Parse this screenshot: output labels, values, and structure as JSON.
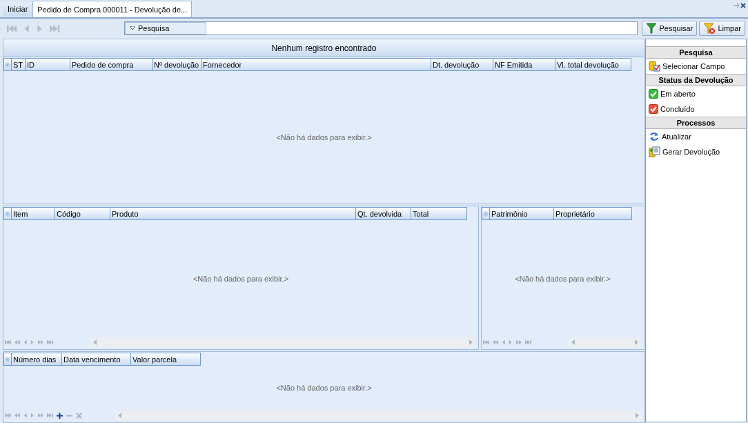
{
  "tabs": [
    {
      "label": "Iniciar",
      "selected": false
    },
    {
      "label": "Pedido de Compra 000011 - Devolução de...",
      "selected": true
    }
  ],
  "toolbar": {
    "search_dropdown": "Pesquisa",
    "buttons": [
      {
        "label": "Pesquisar",
        "kind": "filter"
      },
      {
        "label": "Limpar",
        "kind": "clear"
      }
    ]
  },
  "main_grid": {
    "caption": "Nenhum registro encontrado",
    "columns": [
      "ST",
      "ID",
      "Pedido de compra",
      "Nº devolução",
      "Fornecedor",
      "Dt. devolução",
      "NF Emitida",
      "Vl. total devolução"
    ],
    "empty_text": "<Não há dados para exibir.>"
  },
  "items_grid": {
    "columns": [
      "Item",
      "Código",
      "Produto",
      "Qt. devolvida",
      "Total"
    ],
    "empty_text": "<Não há dados para exibir.>",
    "edit_controls": false
  },
  "assets_grid": {
    "columns": [
      "Patrimônio",
      "Proprietário"
    ],
    "empty_text": "<Não há dados para exibir.>",
    "edit_controls": false
  },
  "installments_grid": {
    "columns": [
      "Número dias",
      "Data vencimento",
      "Valor parcela"
    ],
    "empty_text": "<Não há dados para exibir.>",
    "edit_controls": true
  },
  "side_panel": {
    "sections": [
      {
        "title": "Pesquisa",
        "items": [
          {
            "label": "Selecionar Campo",
            "kind": "select-field"
          }
        ]
      },
      {
        "title": "Status da Devolução",
        "items": [
          {
            "label": "Em aberto",
            "kind": "status-open"
          },
          {
            "label": "Concluído",
            "kind": "status-done"
          }
        ]
      },
      {
        "title": "Processos",
        "items": [
          {
            "label": "Atualizar",
            "kind": "refresh"
          },
          {
            "label": "Gerar Devolução",
            "kind": "generate"
          }
        ]
      }
    ]
  }
}
